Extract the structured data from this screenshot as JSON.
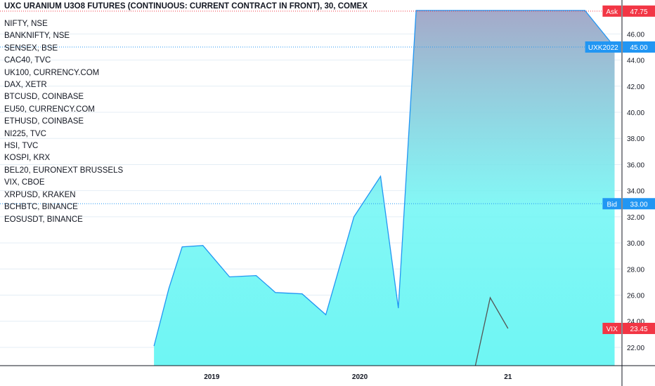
{
  "header": {
    "title": "UXC URANIUM U3O8 FUTURES (CONTINUOUS: CURRENT CONTRACT IN FRONT), 30, COMEX"
  },
  "symbols": [
    "NIFTY, NSE",
    "BANKNIFTY, NSE",
    "SENSEX, BSE",
    "CAC40, TVC",
    "UK100, CURRENCY.COM",
    "DAX, XETR",
    "BTCUSD, COINBASE",
    "EU50, CURRENCY.COM",
    "ETHUSD, COINBASE",
    "NI225, TVC",
    "HSI, TVC",
    "KOSPI, KRX",
    "BEL20, EURONEXT BRUSSELS",
    "VIX, CBOE",
    "XRPUSD, KRAKEN",
    "BCHBTC, BINANCE",
    "EOSUSDT, BINANCE"
  ],
  "colors": {
    "main_line": "#2196f3",
    "area_top": "#a5a9c9",
    "area_bottom": "#6ef6f4",
    "compare_line": "#555555",
    "ask": "#f23645",
    "bid": "#2196f3",
    "grid": "#e4eef5",
    "axis_text": "#131722"
  },
  "chart_data": {
    "type": "area",
    "ylim": [
      20.6,
      48.6
    ],
    "y_ticks": [
      "46.00",
      "44.00",
      "42.00",
      "40.00",
      "38.00",
      "36.00",
      "34.00",
      "32.00",
      "30.00",
      "28.00",
      "26.00",
      "24.00",
      "22.00"
    ],
    "y_tick_values": [
      46,
      44,
      42,
      40,
      38,
      36,
      34,
      32,
      30,
      28,
      26,
      24,
      22
    ],
    "x_ticks": [
      "2019",
      "2020",
      "21"
    ],
    "x_tick_values": [
      2019.0,
      2020.0,
      2021.0
    ],
    "xlim": [
      2017.57,
      2021.77
    ],
    "series": [
      {
        "name": "UXK2022",
        "x": [
          2018.61,
          2018.71,
          2018.8,
          2018.94,
          2019.12,
          2019.3,
          2019.43,
          2019.61,
          2019.77,
          2019.96,
          2020.14,
          2020.26,
          2020.38,
          2020.55,
          2020.72,
          2020.82,
          2020.88,
          2021.38,
          2021.52,
          2021.72
        ],
        "values": [
          22.1,
          26.5,
          29.7,
          29.8,
          27.4,
          27.5,
          26.2,
          26.1,
          24.5,
          32.0,
          35.1,
          25.0,
          47.8,
          47.8,
          47.8,
          47.8,
          47.8,
          47.8,
          47.8,
          45.0
        ]
      },
      {
        "name": "VIX",
        "x": [
          2020.78,
          2020.88,
          2021.0
        ],
        "values": [
          20.6,
          25.8,
          23.45
        ]
      }
    ],
    "price_labels": [
      {
        "name": "Ask",
        "value": "47.75",
        "y": 47.75,
        "line": "dotted-red"
      },
      {
        "name": "UXK2022",
        "value": "45.00",
        "y": 45.0,
        "line": "dotted-blue"
      },
      {
        "name": "Bid",
        "value": "33.00",
        "y": 33.0,
        "line": "dotted-blue"
      },
      {
        "name": "VIX",
        "value": "23.45",
        "y": 23.45,
        "line": "none"
      }
    ]
  }
}
